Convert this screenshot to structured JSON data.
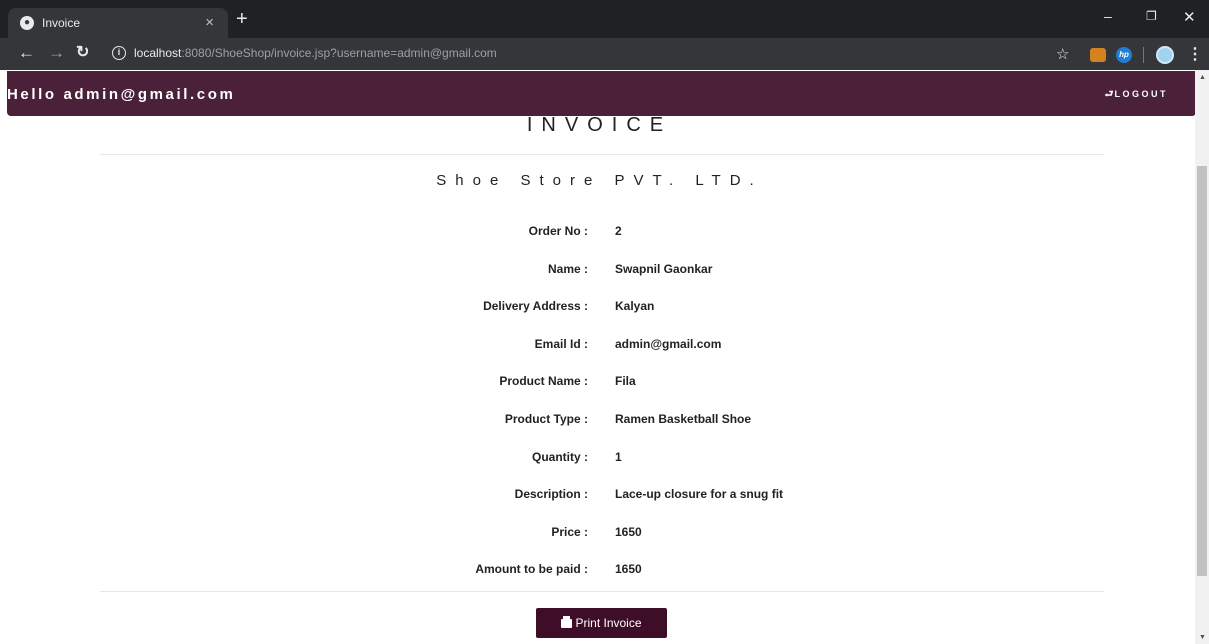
{
  "browser": {
    "tab_title": "Invoice",
    "tab_close": "×",
    "new_tab": "+",
    "url_host": "localhost",
    "url_rest": ":8080/ShoeShop/invoice.jsp?username=admin@gmail.com",
    "icons": [
      "globe-icon",
      "back-arrow-icon",
      "forward-arrow-icon",
      "reload-icon",
      "info-icon",
      "star-icon",
      "extension-icon",
      "hp-extension-icon",
      "profile-avatar-icon",
      "menu-dots-icon",
      "minimize-icon",
      "restore-icon",
      "close-window-icon"
    ]
  },
  "navbar": {
    "greeting": "Hello admin@gmail.com",
    "logout_label": "LOGOUT",
    "bg_color": "#4a2138"
  },
  "invoice": {
    "heading": "INVOICE",
    "company": "Shoe Store PVT. LTD.",
    "rows": [
      {
        "label": "Order No :",
        "value": "2"
      },
      {
        "label": "Name :",
        "value": "Swapnil Gaonkar"
      },
      {
        "label": "Delivery Address :",
        "value": "Kalyan"
      },
      {
        "label": "Email Id :",
        "value": "admin@gmail.com"
      },
      {
        "label": "Product Name :",
        "value": "Fila"
      },
      {
        "label": "Product Type :",
        "value": "Ramen Basketball Shoe"
      },
      {
        "label": "Quantity :",
        "value": "1"
      },
      {
        "label": "Description :",
        "value": "Lace-up closure for a snug fit"
      },
      {
        "label": "Price :",
        "value": "1650"
      },
      {
        "label": "Amount to be paid :",
        "value": "1650"
      }
    ],
    "print_button_label": "Print Invoice",
    "button_color": "#3e0d27"
  }
}
